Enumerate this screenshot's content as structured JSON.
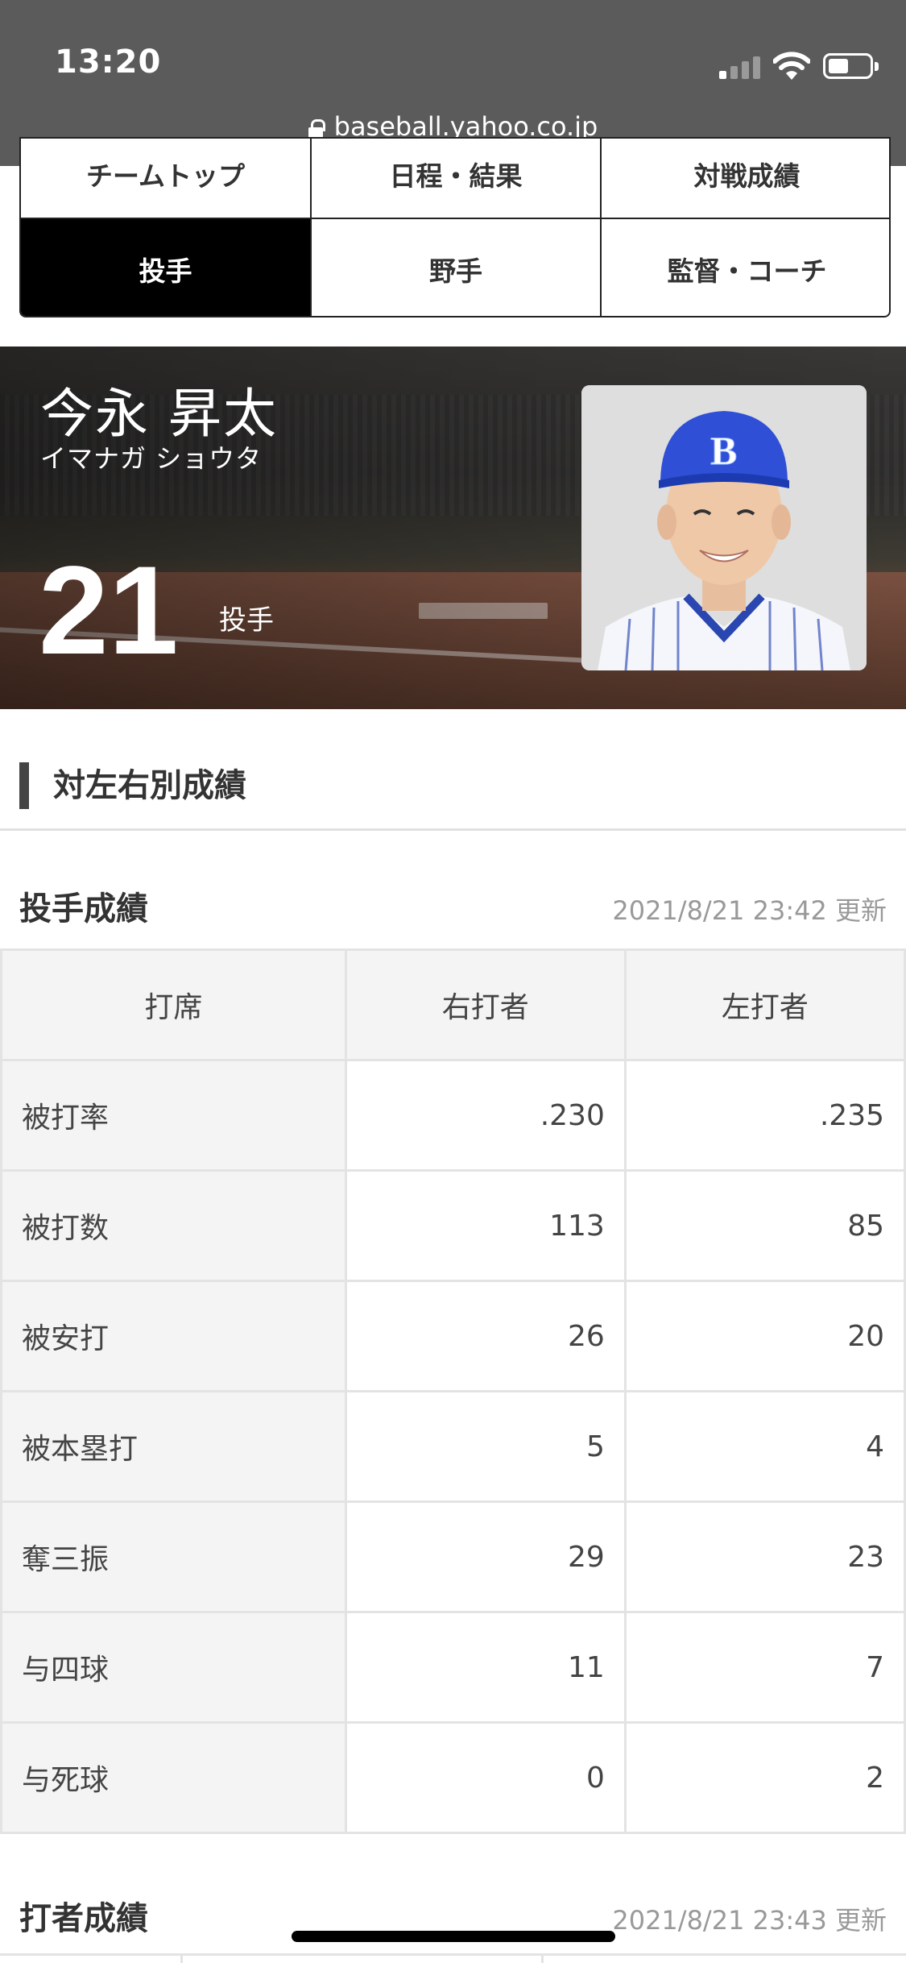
{
  "status_bar": {
    "time": "13:20"
  },
  "browser": {
    "url": "baseball.yahoo.co.jp"
  },
  "nav": {
    "items": [
      {
        "label": "チームトップ"
      },
      {
        "label": "日程・結果"
      },
      {
        "label": "対戦成績"
      },
      {
        "label": "投手",
        "active": true
      },
      {
        "label": "野手"
      },
      {
        "label": "監督・コーチ"
      }
    ]
  },
  "player": {
    "name": "今永 昇太",
    "kana": "イマナガ ショウタ",
    "number": "21",
    "position": "投手"
  },
  "section": {
    "title": "対左右別成績"
  },
  "pitching": {
    "title": "投手成績",
    "updated": "2021/8/21 23:42 更新",
    "headers": [
      "打席",
      "右打者",
      "左打者"
    ],
    "rows": [
      {
        "label": "被打率",
        "right": ".230",
        "left": ".235"
      },
      {
        "label": "被打数",
        "right": "113",
        "left": "85"
      },
      {
        "label": "被安打",
        "right": "26",
        "left": "20"
      },
      {
        "label": "被本塁打",
        "right": "5",
        "left": "4"
      },
      {
        "label": "奪三振",
        "right": "29",
        "left": "23"
      },
      {
        "label": "与四球",
        "right": "11",
        "left": "7"
      },
      {
        "label": "与死球",
        "right": "0",
        "left": "2"
      }
    ]
  },
  "batting": {
    "title": "打者成績",
    "updated": "2021/8/21 23:43 更新"
  },
  "colors": {
    "nav_active_bg": "#000000",
    "topbar_bg": "#5b5b5b",
    "accent_bar": "#444444"
  }
}
